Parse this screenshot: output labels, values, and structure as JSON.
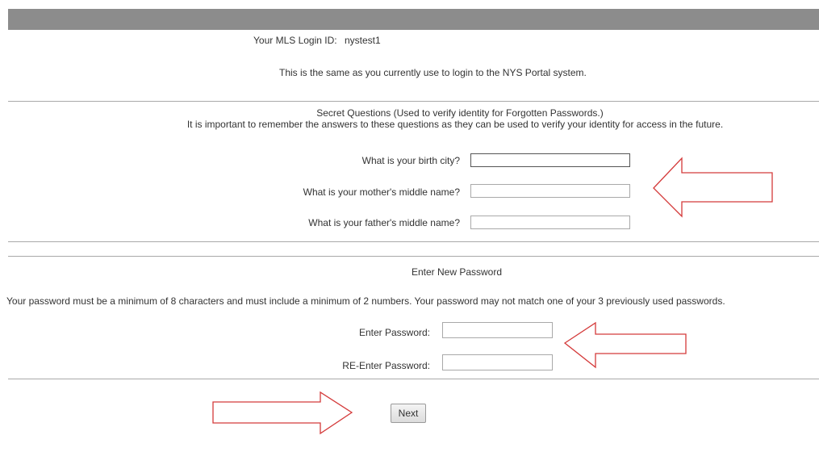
{
  "login": {
    "label": "Your MLS Login ID:",
    "value": "nystest1",
    "note": "This is the same as you currently use to login to the NYS Portal system."
  },
  "secret_questions": {
    "heading": "Secret Questions (Used to verify identity for Forgotten Passwords.)",
    "note": "It is important to remember the answers to these questions as they can be used to verify your identity for access in the future.",
    "q1": {
      "label": "What is your birth city?",
      "value": ""
    },
    "q2": {
      "label": "What is your mother's middle name?",
      "value": ""
    },
    "q3": {
      "label": "What is your father's middle name?",
      "value": ""
    }
  },
  "password": {
    "heading": "Enter New Password",
    "rules": "Your password must be a minimum of 8 characters and must include a minimum of 2 numbers. Your password may not match one of your 3 previously used passwords.",
    "enter_label": "Enter Password:",
    "reenter_label": "RE-Enter Password:"
  },
  "next_button": {
    "label": "Next"
  },
  "colors": {
    "header_bar": "#8c8c8c",
    "annotation_arrow": "#d43a3a",
    "divider": "#a9a9a9"
  },
  "annotations": {
    "icon": "red-outline-arrow-icon"
  }
}
